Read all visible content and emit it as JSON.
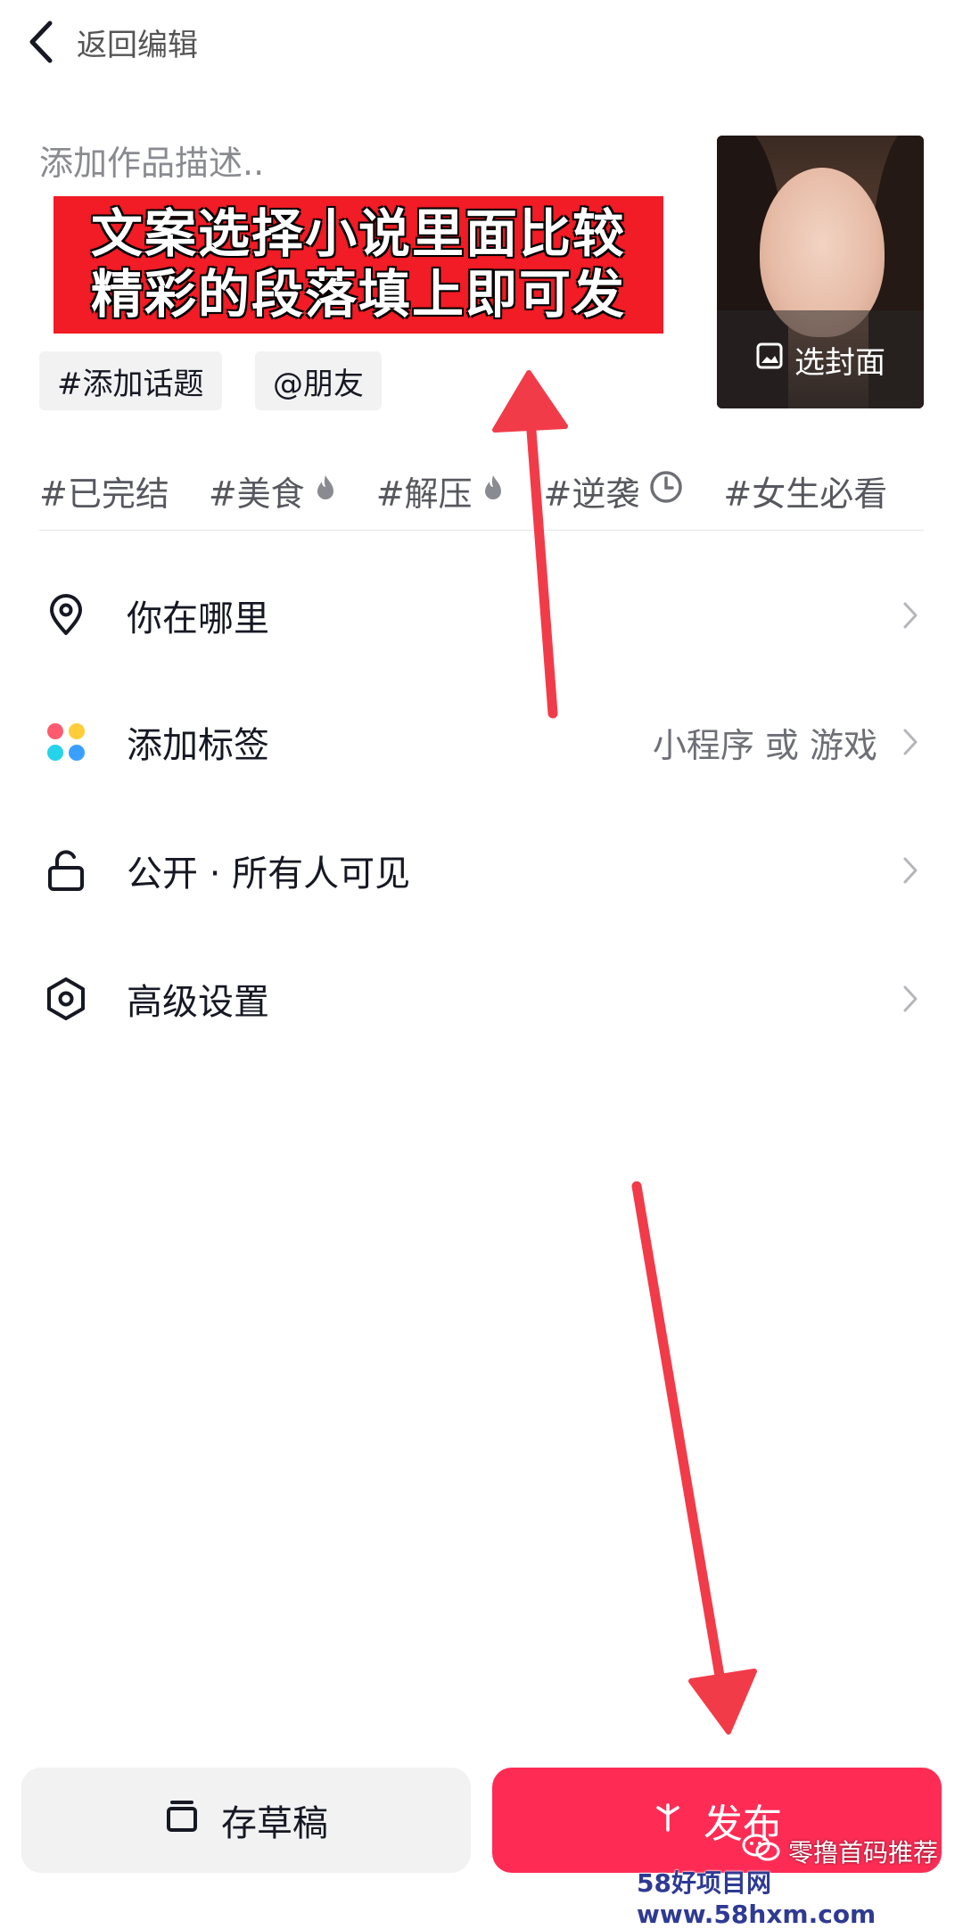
{
  "colors": {
    "publish": "#fe2c55",
    "banner": "#f11c25",
    "arrow": "#f23b49"
  },
  "header": {
    "back_label": "返回编辑"
  },
  "description": {
    "placeholder": "添加作品描述..",
    "overlay_line1": "文案选择小说里面比较",
    "overlay_line2": "精彩的段落填上即可发"
  },
  "chips": {
    "topic": "#添加话题",
    "friend": "@朋友"
  },
  "cover": {
    "label": "选封面"
  },
  "hashtags": [
    {
      "text": "#已完结",
      "icon": "none"
    },
    {
      "text": "#美食",
      "icon": "fire-icon"
    },
    {
      "text": "#解压",
      "icon": "fire-icon"
    },
    {
      "text": "#逆袭",
      "icon": "clock-icon"
    },
    {
      "text": "#女生必看",
      "icon": "none"
    }
  ],
  "settings": {
    "location": {
      "label": "你在哪里",
      "value": ""
    },
    "tag": {
      "label": "添加标签",
      "value": "小程序 或 游戏"
    },
    "visibility": {
      "label": "公开 · 所有人可见",
      "value": ""
    },
    "advanced": {
      "label": "高级设置",
      "value": ""
    }
  },
  "footer": {
    "draft_label": "存草稿",
    "publish_label": "发布"
  },
  "watermarks": {
    "wechat": "零撸首码推荐",
    "site": "58好项目网www.58hxm.com"
  }
}
